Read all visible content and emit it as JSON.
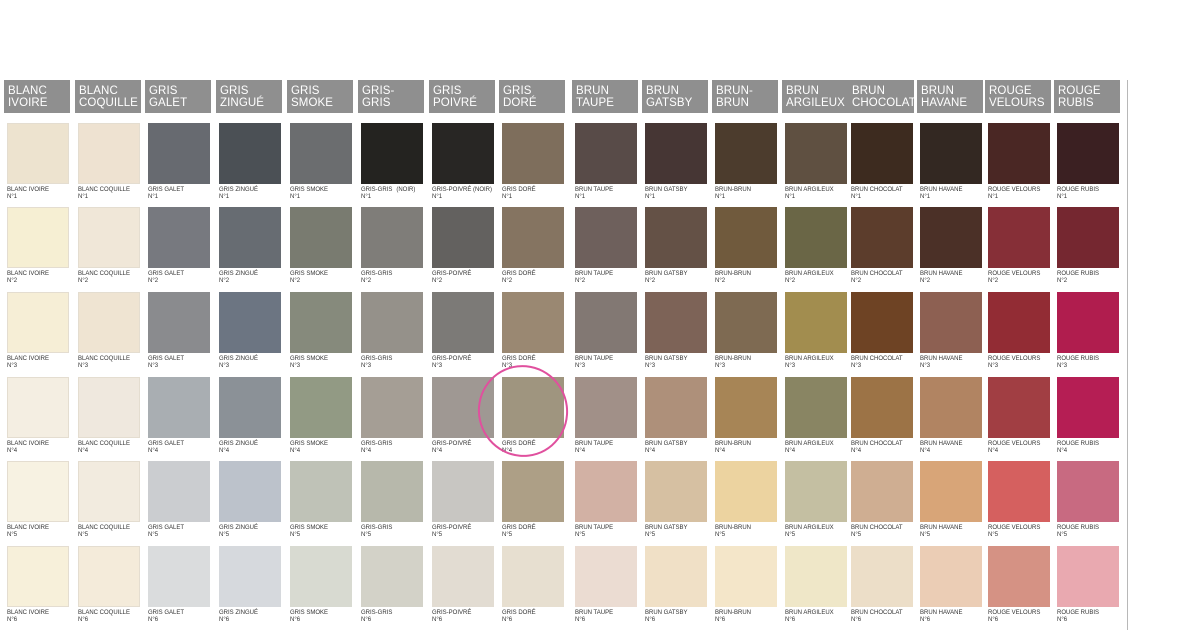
{
  "columns": [
    {
      "h1": "BLANC",
      "h2": "IVOIRE",
      "name": "BLANC IVOIRE",
      "colors": [
        "#ede3cf",
        "#f6efd3",
        "#f6eed6",
        "#f4eee2",
        "#f7f2e2",
        "#f7f0da"
      ]
    },
    {
      "h1": "BLANC",
      "h2": "COQUILLE",
      "name": "BLANC COQUILLE",
      "colors": [
        "#eee2d1",
        "#f0e7d8",
        "#efe4d2",
        "#efe8de",
        "#f2ebdf",
        "#f4ebda"
      ]
    },
    {
      "h1": "GRIS",
      "h2": "GALET",
      "name": "GRIS GALET",
      "colors": [
        "#676a70",
        "#77797f",
        "#8a8b8e",
        "#a9aeb2",
        "#cbcdd0",
        "#dadcdd"
      ]
    },
    {
      "h1": "GRIS",
      "h2": "ZINGUÉ",
      "name": "GRIS ZINGUÉ",
      "colors": [
        "#4b5055",
        "#676c72",
        "#6c7582",
        "#8b9197",
        "#bcc2cb",
        "#d6d9dd"
      ]
    },
    {
      "h1": "GRIS",
      "h2": "SMOKE",
      "name": "GRIS SMOKE",
      "colors": [
        "#6b6d6f",
        "#797b70",
        "#868a7c",
        "#929a84",
        "#bfc2b7",
        "#d8dad1"
      ]
    },
    {
      "h1": "GRIS-",
      "h2": "GRIS",
      "name": "GRIS-GRIS",
      "colors": [
        "#242320",
        "#7f7d79",
        "#95918a",
        "#a59e95",
        "#b7b8ab",
        "#d3d2c8"
      ]
    },
    {
      "h1": "GRIS",
      "h2": "POIVRÉ",
      "name": "GRIS-POIVRÉ",
      "colors": [
        "#282624",
        "#63615f",
        "#7c7a77",
        "#9f9893",
        "#c8c6c2",
        "#e2dcd2"
      ]
    },
    {
      "h1": "GRIS",
      "h2": "DORÉ",
      "name": "GRIS DORÉ",
      "colors": [
        "#7e6e5c",
        "#857461",
        "#9a8872",
        "#9f957f",
        "#ad9f86",
        "#e7dfd0"
      ]
    },
    {
      "h1": "BRUN",
      "h2": "TAUPE",
      "name": "BRUN TAUPE",
      "colors": [
        "#584b48",
        "#6e605c",
        "#827873",
        "#a19088",
        "#d2b1a4",
        "#ebdcd2"
      ]
    },
    {
      "h1": "BRUN",
      "h2": "GATSBY",
      "name": "BRUN GATSBY",
      "colors": [
        "#463634",
        "#645146",
        "#7d6357",
        "#ae907a",
        "#d6c0a2",
        "#f0e0c6"
      ]
    },
    {
      "h1": "BRUN-",
      "h2": "BRUN",
      "name": "BRUN-BRUN",
      "colors": [
        "#4c3c2d",
        "#705a3d",
        "#7e6a52",
        "#a78556",
        "#ecd3a0",
        "#f4e6c9"
      ]
    },
    {
      "h1": "BRUN",
      "h2": "ARGILEUX",
      "name": "BRUN ARGILEUX",
      "colors": [
        "#5f5041",
        "#6a6646",
        "#a28d4f",
        "#898563",
        "#c4bfa2",
        "#efe7c8"
      ]
    },
    {
      "h1": "BRUN",
      "h2": "CHOCOLAT",
      "name": "BRUN CHOCOLAT",
      "colors": [
        "#3d2b1f",
        "#5c3d2c",
        "#6e4324",
        "#9c7346",
        "#cfae92",
        "#ecdec8"
      ]
    },
    {
      "h1": "BRUN",
      "h2": "HAVANE",
      "name": "BRUN HAVANE",
      "colors": [
        "#332822",
        "#4b3027",
        "#8d6052",
        "#b18462",
        "#d8a578",
        "#ebcdb5"
      ]
    },
    {
      "h1": "ROUGE",
      "h2": "VELOURS",
      "name": "ROUGE VELOURS",
      "colors": [
        "#4a2724",
        "#862f37",
        "#922c34",
        "#a13e43",
        "#d5605f",
        "#d59284"
      ]
    },
    {
      "h1": "ROUGE",
      "h2": "RUBIS",
      "name": "ROUGE RUBIS",
      "colors": [
        "#3b2022",
        "#752730",
        "#b01d4e",
        "#b51e54",
        "#c86a81",
        "#e9a9b0"
      ]
    }
  ],
  "row_numbers": [
    "N°1",
    "N°2",
    "N°3",
    "N°4",
    "N°5",
    "N°6"
  ],
  "notes": {
    "gris_gris_row1": "(NOIR)",
    "gris_poivre_row1": "GRIS-POIVRÉ (NOIR)"
  },
  "highlight": {
    "color": "#e0509e",
    "column": "GRIS DORÉ",
    "row": "N°4"
  }
}
